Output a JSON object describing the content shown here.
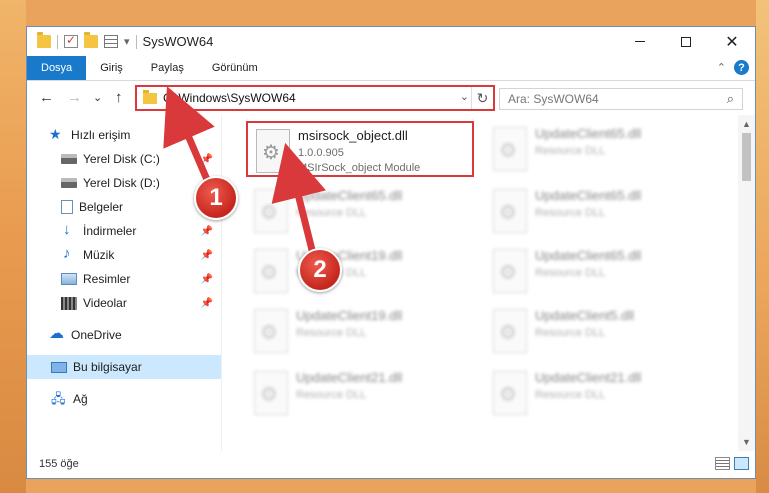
{
  "window": {
    "title": "SysWOW64",
    "controls": {
      "minimize": "minimize",
      "maximize": "maximize",
      "close": "✕"
    }
  },
  "ribbon": {
    "tabs": [
      "Dosya",
      "Giriş",
      "Paylaş",
      "Görünüm"
    ],
    "help": "?",
    "collapse": "⌃"
  },
  "addressbar": {
    "back": "←",
    "forward": "→",
    "recent": "⌄",
    "up": "↑",
    "path": "C:\\Windows\\SysWOW64",
    "dropdown": "⌄",
    "refresh": "↻"
  },
  "search": {
    "placeholder": "Ara: SysWOW64",
    "icon": "⌕"
  },
  "nav": {
    "items": [
      {
        "label": "Hızlı erişim",
        "icon": "star-icon",
        "pinned": false
      },
      {
        "label": "Yerel Disk (C:)",
        "icon": "disk-icon",
        "pinned": true
      },
      {
        "label": "Yerel Disk (D:)",
        "icon": "disk-icon",
        "pinned": false
      },
      {
        "label": "Belgeler",
        "icon": "document-icon",
        "pinned": true
      },
      {
        "label": "İndirmeler",
        "icon": "download-icon",
        "pinned": true
      },
      {
        "label": "Müzik",
        "icon": "music-icon",
        "pinned": true
      },
      {
        "label": "Resimler",
        "icon": "pictures-icon",
        "pinned": true
      },
      {
        "label": "Videolar",
        "icon": "videos-icon",
        "pinned": true
      },
      {
        "label": "OneDrive",
        "icon": "cloud-icon",
        "pinned": false
      },
      {
        "label": "Bu bilgisayar",
        "icon": "computer-icon",
        "pinned": false,
        "selected": true
      },
      {
        "label": "Ağ",
        "icon": "network-icon",
        "pinned": false
      }
    ],
    "pin_glyph": "📌"
  },
  "files": {
    "highlighted": {
      "name": "msirsock_object.dll",
      "version": "1.0.0.905",
      "description": "MSIrSock_object Module"
    },
    "others": [
      {
        "name": "UpdateClient65.dll",
        "type": "Resource DLL"
      },
      {
        "name": "UpdateClient65.dll",
        "type": "Resource DLL"
      },
      {
        "name": "UpdateClient65.dll",
        "type": "Resource DLL"
      },
      {
        "name": "UpdateClient19.dll",
        "type": "Resource DLL"
      },
      {
        "name": "UpdateClient65.dll",
        "type": "Resource DLL"
      },
      {
        "name": "UpdateClient19.dll",
        "type": "Resource DLL"
      },
      {
        "name": "UpdateClient5.dll",
        "type": "Resource DLL"
      },
      {
        "name": "UpdateClient21.dll",
        "type": "Resource DLL"
      },
      {
        "name": "UpdateClient21.dll",
        "type": "Resource DLL"
      }
    ]
  },
  "status": {
    "item_count": "155 öğe"
  },
  "annotations": {
    "badge1": "1",
    "badge2": "2",
    "color": "#d9393a"
  }
}
